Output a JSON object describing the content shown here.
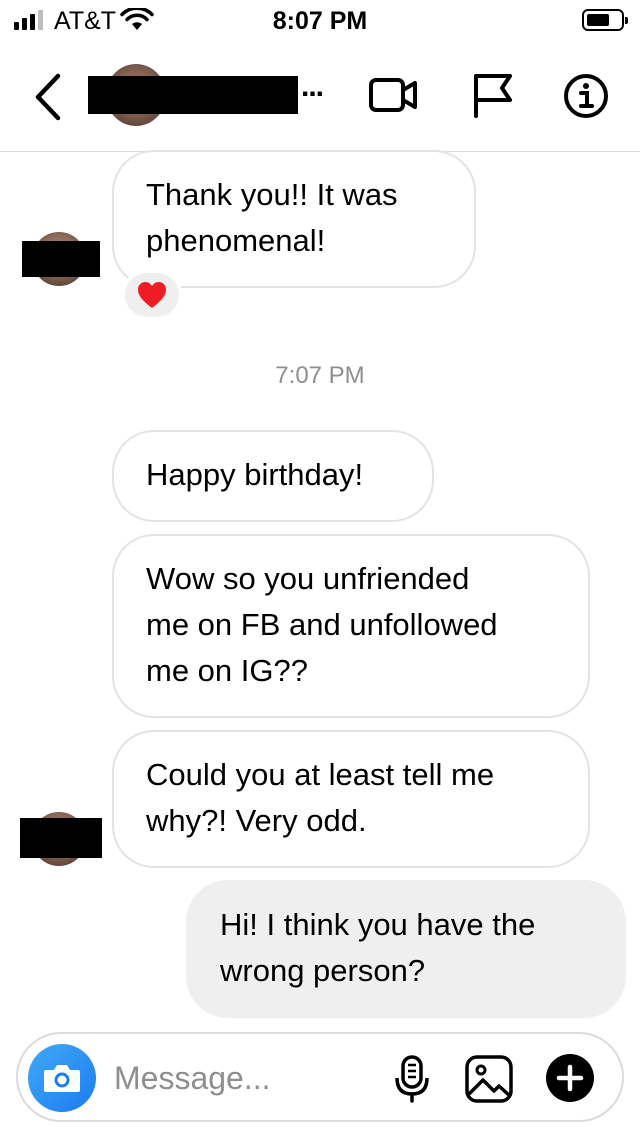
{
  "status_bar": {
    "carrier": "AT&T",
    "time": "8:07 PM",
    "signal_bars_active": 3,
    "signal_bars_total": 4
  },
  "header": {
    "name_ellipsis": "...",
    "icons": [
      "back-chevron-icon",
      "video-call-icon",
      "flag-icon",
      "info-icon"
    ]
  },
  "messages": [
    {
      "direction": "incoming",
      "text": "Thank you!! It was\nphenomenal!",
      "reaction": "❤️"
    },
    {
      "direction": "incoming",
      "text": "Happy birthday!"
    },
    {
      "direction": "incoming",
      "text": "Wow so you unfriended\nme on FB and unfollowed\nme on IG??"
    },
    {
      "direction": "incoming",
      "text": "Could you at least tell me\nwhy?! Very odd."
    },
    {
      "direction": "outgoing",
      "text": "Hi! I think you have the\nwrong person?"
    }
  ],
  "timestamp": "7:07 PM",
  "composer": {
    "placeholder": "Message...",
    "icons": [
      "camera-icon",
      "microphone-icon",
      "gallery-icon",
      "plus-icon"
    ]
  },
  "colors": {
    "camera_button": "#1e7cf0",
    "incoming_border": "#e3e3e3",
    "outgoing_fill": "#efefef",
    "timestamp": "#8e8e8e"
  }
}
